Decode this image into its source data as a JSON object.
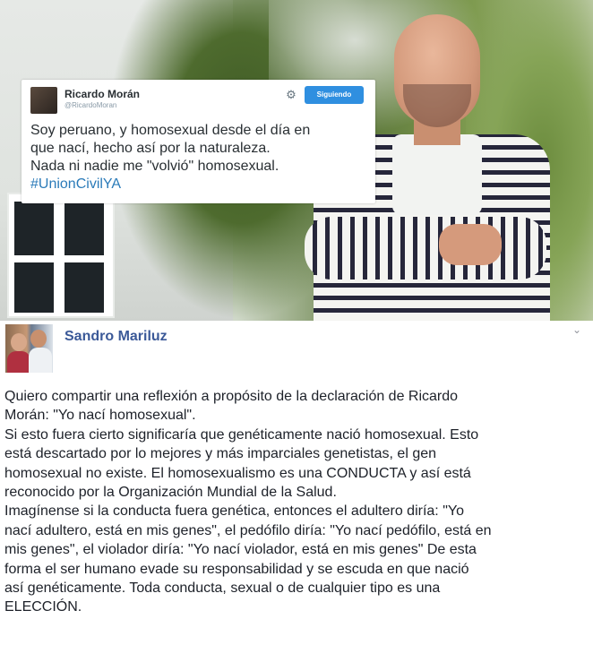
{
  "tweet": {
    "name": "Ricardo Morán",
    "handle": "@RicardoMoran",
    "settings_icon": "gear-icon",
    "follow_label": "Siguiendo",
    "lines": [
      "Soy peruano, y homosexual desde el día en",
      "que nací, hecho así por la naturaleza.",
      "Nada ni nadie me \"volvió\" homosexual."
    ],
    "hashtag": "#UnionCivilYA"
  },
  "post": {
    "author": "Sandro Mariluz",
    "menu_icon": "chevron-down-icon",
    "lines": [
      "Quiero compartir una reflexión a propósito de la declaración de Ricardo",
      "Morán: \"Yo nací homosexual\".",
      "Si esto fuera cierto significaría que genéticamente nació homosexual. Esto",
      "está descartado por lo mejores y más imparciales genetistas, el gen",
      "homosexual no existe. El homosexualismo es una CONDUCTA y así está",
      "reconocido por la Organización Mundial de la Salud.",
      "Imagínense si la conducta fuera genética, entonces el adultero diría: \"Yo",
      "nací adultero, está en mis genes\", el pedófilo diría: \"Yo nací pedófilo, está en",
      "mis genes\", el violador diría: \"Yo nací violador, está en mis genes\" De esta",
      "forma el ser humano evade su responsabilidad y se escuda en que nació",
      "así genéticamente. Toda conducta, sexual o de cualquier tipo es una",
      "ELECCIÓN."
    ]
  },
  "colors": {
    "author_link": "#3b5998",
    "follow_button": "#2f8fe0",
    "hashtag": "#2b7bb9"
  }
}
